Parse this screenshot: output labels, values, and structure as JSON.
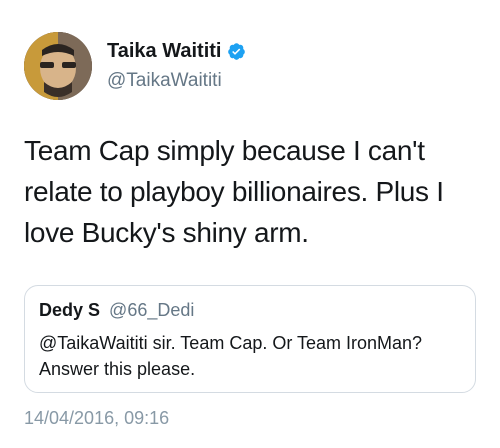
{
  "author": {
    "name": "Taika Waititi",
    "handle": "@TaikaWaititi",
    "verified_icon": "verified-badge-icon",
    "verified_color": "#1da1f2"
  },
  "tweet": {
    "text": "Team Cap simply because I can't relate to playboy billionaires. Plus I love Bucky's shiny arm.",
    "timestamp": "14/04/2016, 09:16"
  },
  "quoted_tweet": {
    "name": "Dedy S",
    "handle": "@66_Dedi",
    "text": "@TaikaWaititi sir. Team Cap. Or Team IronMan? Answer this please."
  },
  "colors": {
    "text_primary": "#14171a",
    "text_secondary": "#657786",
    "border": "#d4dbe2"
  }
}
